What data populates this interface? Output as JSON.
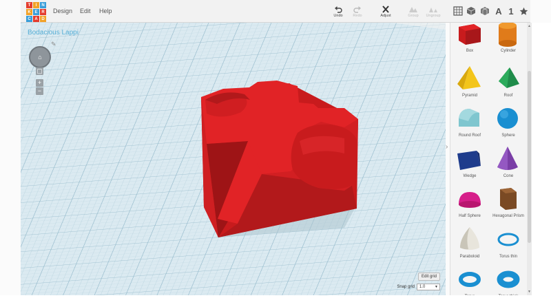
{
  "logo_letters": [
    "T",
    "I",
    "N",
    "K",
    "E",
    "R",
    "C",
    "A",
    "D"
  ],
  "logo_colors": [
    "#e43b2d",
    "#f2a126",
    "#3a9ed9",
    "#f2a126",
    "#3a9ed9",
    "#e43b2d",
    "#3a9ed9",
    "#e43b2d",
    "#f2a126"
  ],
  "menu": {
    "design": "Design",
    "edit": "Edit",
    "help": "Help"
  },
  "toolbar": {
    "undo": "Undo",
    "redo": "Redo",
    "adjust": "Adjust",
    "group": "Group",
    "ungroup": "Ungroup"
  },
  "views": {
    "text_tool": "A",
    "number_tool": "1"
  },
  "workplane": {
    "title": "Bodacious Lappi",
    "edit_grid": "Edit grid",
    "snap_grid_label": "Snap grid",
    "snap_grid_value": "1.0"
  },
  "colors": {
    "accent": "#55aed6",
    "object": "#e02326",
    "grid_bg": "#d6e8f0"
  },
  "shapes": [
    {
      "label": "Box",
      "icon": "box-icon"
    },
    {
      "label": "Cylinder",
      "icon": "cylinder-icon"
    },
    {
      "label": "Pyramid",
      "icon": "pyramid-icon"
    },
    {
      "label": "Roof",
      "icon": "roof-icon"
    },
    {
      "label": "Round Roof",
      "icon": "round-roof-icon"
    },
    {
      "label": "Sphere",
      "icon": "sphere-icon"
    },
    {
      "label": "Wedge",
      "icon": "wedge-icon"
    },
    {
      "label": "Cone",
      "icon": "cone-icon"
    },
    {
      "label": "Half Sphere",
      "icon": "half-sphere-icon"
    },
    {
      "label": "Hexagonal Prism",
      "icon": "hexagonal-prism-icon"
    },
    {
      "label": "Paraboloid",
      "icon": "paraboloid-icon"
    },
    {
      "label": "Torus thin",
      "icon": "torus-thin-icon"
    },
    {
      "label": "Torus",
      "icon": "torus-icon"
    },
    {
      "label": "Torus thick",
      "icon": "torus-thick-icon"
    }
  ]
}
